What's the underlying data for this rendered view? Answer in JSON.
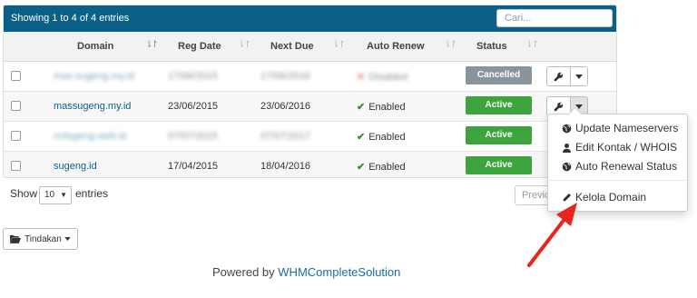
{
  "table": {
    "info": "Showing 1 to 4 of 4 entries",
    "search_placeholder": "Cari...",
    "columns": [
      "Domain",
      "Reg Date",
      "Next Due",
      "Auto Renew",
      "Status"
    ],
    "rows": [
      {
        "domain": "mas-sugeng.my.id",
        "reg_date": "17/06/2015",
        "next_due": "17/06/2016",
        "auto_renew": "Disabled",
        "status": "Cancelled"
      },
      {
        "domain": "massugeng.my.id",
        "reg_date": "23/06/2015",
        "next_due": "23/06/2016",
        "auto_renew": "Enabled",
        "status": "Active"
      },
      {
        "domain": "m4sgeng.web.id",
        "reg_date": "07/07/2015",
        "next_due": "07/07/2017",
        "auto_renew": "Enabled",
        "status": "Active"
      },
      {
        "domain": "sugeng.id",
        "reg_date": "17/04/2015",
        "next_due": "18/04/2016",
        "auto_renew": "Enabled",
        "status": "Active"
      }
    ]
  },
  "dropdown": {
    "items": [
      "Update Nameservers",
      "Edit Kontak / WHOIS",
      "Auto Renewal Status"
    ],
    "manage": "Kelola Domain"
  },
  "footer": {
    "show_label": "Show",
    "page_size": "10",
    "entries_label": "entries",
    "previous_label": "Previous",
    "actions_label": "Tindakan",
    "powered_by": "Powered by",
    "powered_link": "WHMCompleteSolution"
  },
  "colors": {
    "header": "#0b6088",
    "active": "#3da43d",
    "cancelled": "#8a949d",
    "arrow": "#e8241c"
  },
  "icons": [
    "wrench-icon",
    "caret-down-icon",
    "globe-icon",
    "user-icon",
    "pencil-icon",
    "folder-open-icon",
    "check-icon",
    "x-icon",
    "sort-icon"
  ]
}
